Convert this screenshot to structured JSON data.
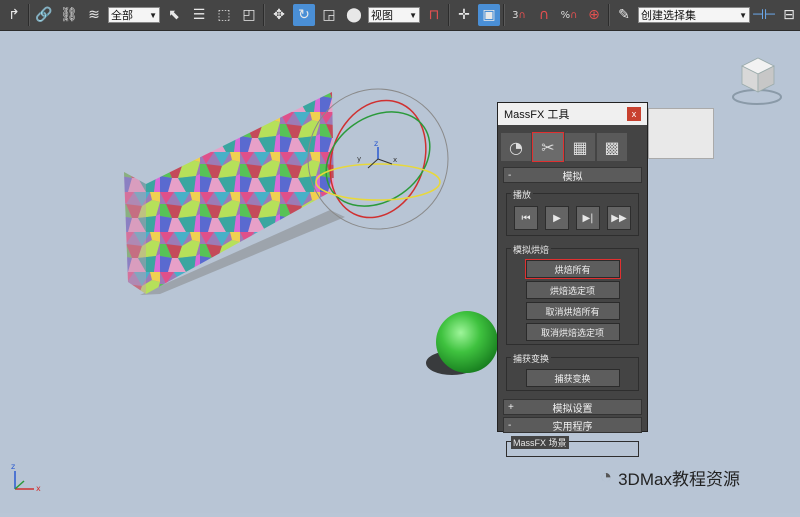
{
  "toolbar": {
    "selection_filter": "全部",
    "view_dropdown": "视图",
    "named_selection": "创建选择集",
    "snap3": "3",
    "angle_snap": "∩",
    "percent_snap": "%"
  },
  "dialog": {
    "title": "MassFX 工具",
    "close": "x",
    "rollout_sim": "模拟",
    "group_play": "播放",
    "group_bake": "模拟烘焙",
    "bake_all": "烘焙所有",
    "bake_selected": "烘焙选定项",
    "unbake_all": "取消烘焙所有",
    "unbake_selected": "取消烘焙选定项",
    "group_capture": "捕获变换",
    "capture_transform": "捕获变换",
    "rollout_settings": "模拟设置",
    "rollout_utils": "实用程序",
    "group_scene": "MassFX 场景",
    "sign_minus": "-",
    "sign_plus": "+"
  },
  "gizmo_axis": "z",
  "gizmo_axis_y": "y",
  "gizmo_axis_x": "x",
  "corner_axis_z": "z",
  "corner_axis_x": "x",
  "watermark": "3DMax教程资源",
  "colors": {
    "accent": "#4a8fd6",
    "highlight": "#e03030"
  }
}
